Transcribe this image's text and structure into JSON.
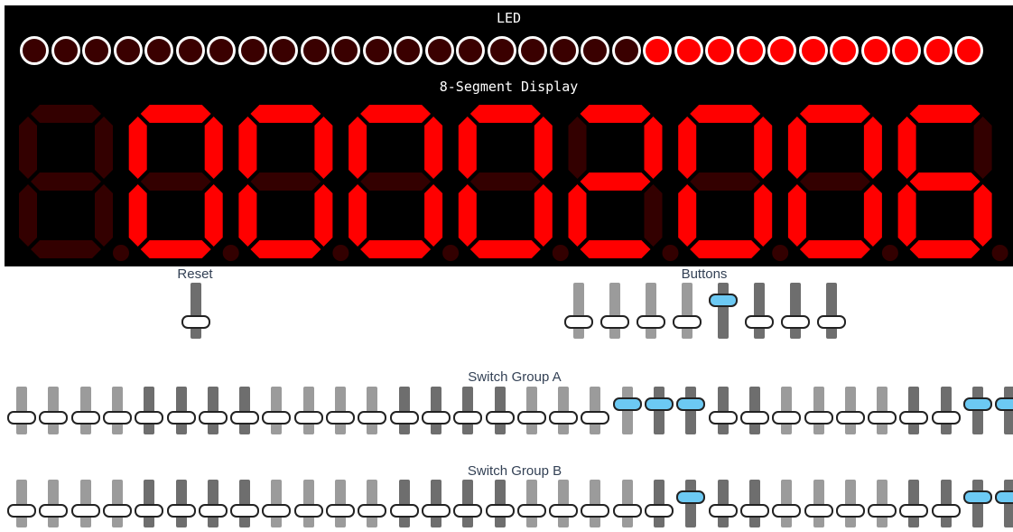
{
  "led_panel": {
    "title": "LED",
    "count": 31,
    "states": [
      0,
      0,
      0,
      0,
      0,
      0,
      0,
      0,
      0,
      0,
      0,
      0,
      0,
      0,
      0,
      0,
      0,
      0,
      0,
      0,
      1,
      1,
      1,
      1,
      1,
      1,
      1,
      1,
      1,
      1,
      1
    ],
    "on_color": "#ff0000",
    "off_color": "#3a0000"
  },
  "segment_display": {
    "title": "8-Segment Display",
    "digits": [
      {
        "segments": "",
        "dot": false
      },
      {
        "segments": "abcdef",
        "dot": false
      },
      {
        "segments": "abcdef",
        "dot": false
      },
      {
        "segments": "abcdef",
        "dot": false
      },
      {
        "segments": "abcdef",
        "dot": false
      },
      {
        "segments": "abdeg",
        "dot": false
      },
      {
        "segments": "abcdef",
        "dot": false
      },
      {
        "segments": "abcdef",
        "dot": false
      },
      {
        "segments": "acdefg",
        "dot": false
      }
    ],
    "on_color": "#ff0000",
    "off_color": "#330000"
  },
  "reset": {
    "title": "Reset",
    "on": false
  },
  "buttons": {
    "title": "Buttons",
    "states": [
      0,
      0,
      0,
      0,
      1,
      0,
      0,
      0
    ]
  },
  "switch_group_a": {
    "title": "Switch Group A",
    "states": [
      0,
      0,
      0,
      0,
      0,
      0,
      0,
      0,
      0,
      0,
      0,
      0,
      0,
      0,
      0,
      0,
      0,
      0,
      0,
      1,
      1,
      1,
      0,
      0,
      0,
      0,
      0,
      0,
      0,
      0,
      1,
      1
    ]
  },
  "switch_group_b": {
    "title": "Switch Group B",
    "states": [
      0,
      0,
      0,
      0,
      0,
      0,
      0,
      0,
      0,
      0,
      0,
      0,
      0,
      0,
      0,
      0,
      0,
      0,
      0,
      0,
      0,
      1,
      0,
      0,
      0,
      0,
      0,
      0,
      0,
      0,
      1,
      1
    ]
  },
  "colors": {
    "track_light": "#9b9b9b",
    "track_dark": "#6e6e6e",
    "knob_on": "#6cc9f3",
    "knob_off": "#ffffff"
  }
}
